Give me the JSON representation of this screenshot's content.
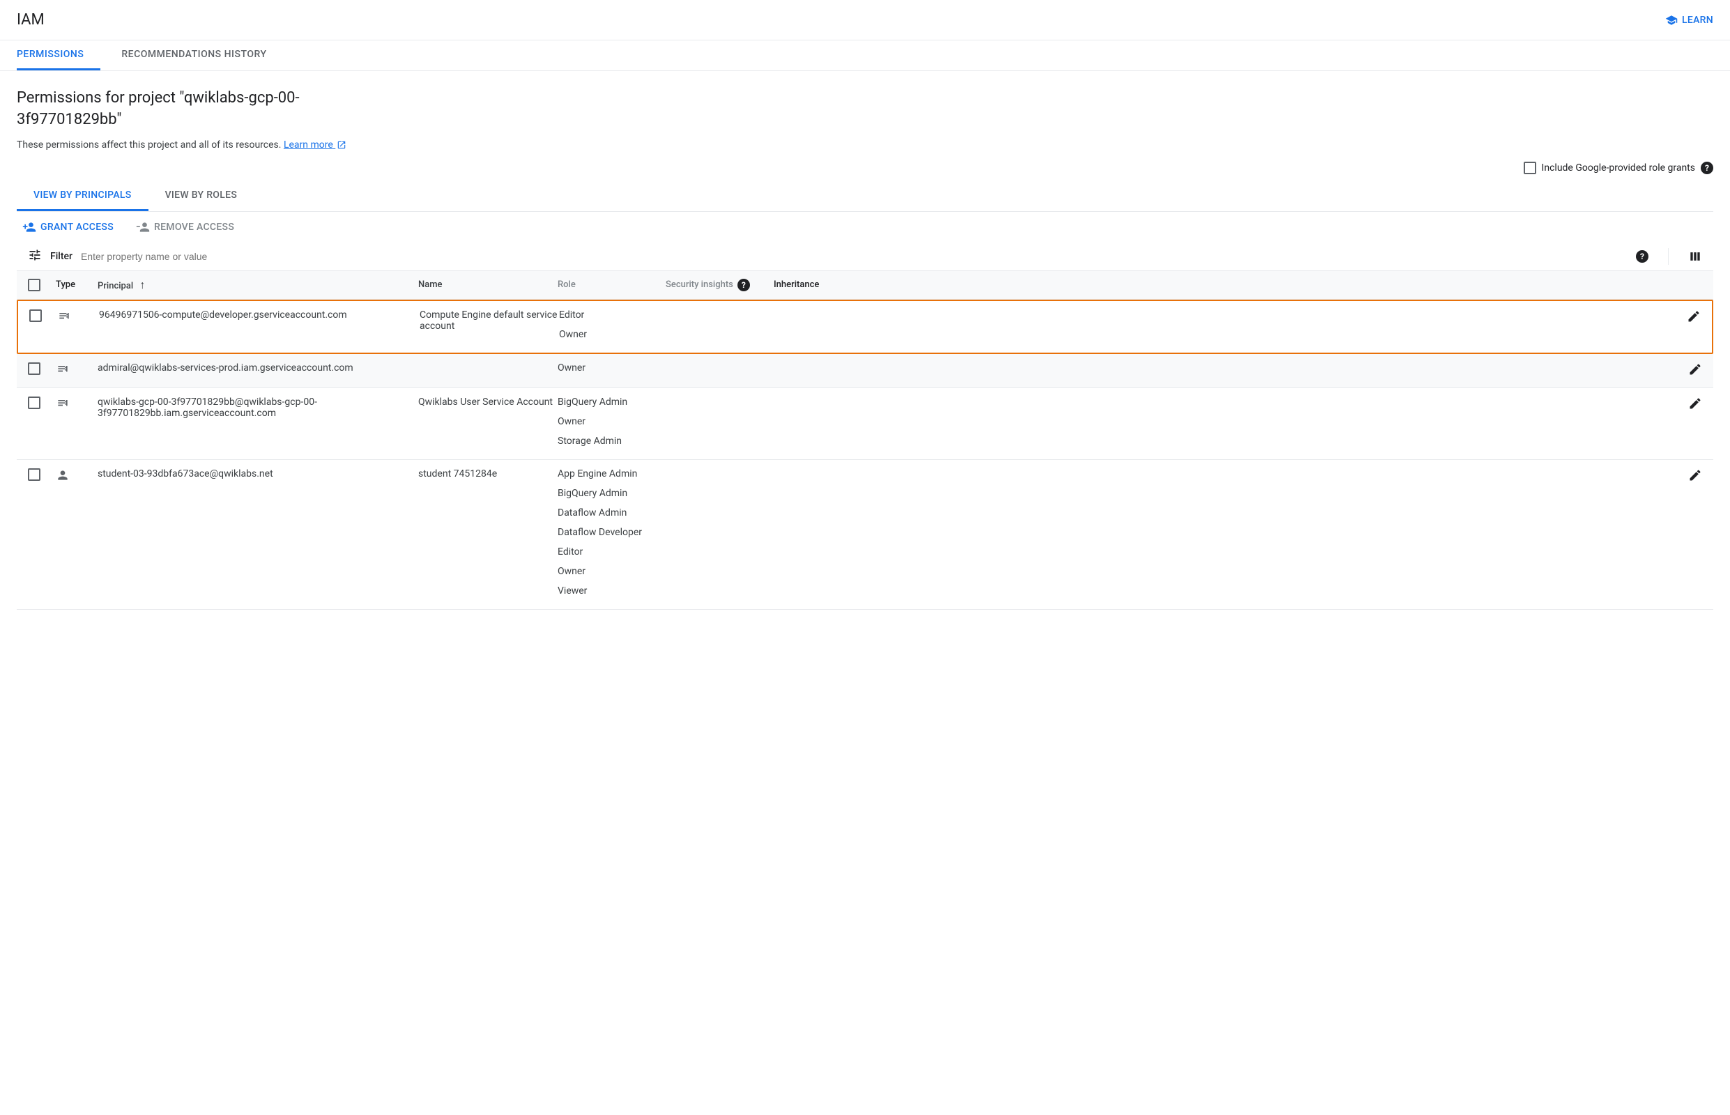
{
  "header": {
    "title": "IAM",
    "learn_label": "LEARN"
  },
  "top_tabs": {
    "permissions": "PERMISSIONS",
    "recommendations": "RECOMMENDATIONS HISTORY"
  },
  "page": {
    "title": "Permissions for project \"qwiklabs-gcp-00-3f97701829bb\"",
    "description": "These permissions affect this project and all of its resources.",
    "learn_more": "Learn more"
  },
  "include_toggle": {
    "label": "Include Google-provided role grants"
  },
  "view_tabs": {
    "principals": "VIEW BY PRINCIPALS",
    "roles": "VIEW BY ROLES"
  },
  "actions": {
    "grant": "GRANT ACCESS",
    "remove": "REMOVE ACCESS"
  },
  "filter": {
    "label": "Filter",
    "placeholder": "Enter property name or value"
  },
  "columns": {
    "type": "Type",
    "principal": "Principal",
    "name": "Name",
    "role": "Role",
    "insights": "Security insights",
    "inheritance": "Inheritance"
  },
  "rows": [
    {
      "type": "service-account",
      "principal": "96496971506-compute@developer.gserviceaccount.com",
      "name": "Compute Engine default service account",
      "roles": [
        "Editor",
        "Owner"
      ],
      "highlighted": true
    },
    {
      "type": "service-account",
      "principal": "admiral@qwiklabs-services-prod.iam.gserviceaccount.com",
      "name": "",
      "roles": [
        "Owner"
      ],
      "alt": true
    },
    {
      "type": "service-account",
      "principal": "qwiklabs-gcp-00-3f97701829bb@qwiklabs-gcp-00-3f97701829bb.iam.gserviceaccount.com",
      "name": "Qwiklabs User Service Account",
      "roles": [
        "BigQuery Admin",
        "Owner",
        "Storage Admin"
      ]
    },
    {
      "type": "user",
      "principal": "student-03-93dbfa673ace@qwiklabs.net",
      "name": "student 7451284e",
      "roles": [
        "App Engine Admin",
        "BigQuery Admin",
        "Dataflow Admin",
        "Dataflow Developer",
        "Editor",
        "Owner",
        "Viewer"
      ]
    }
  ]
}
